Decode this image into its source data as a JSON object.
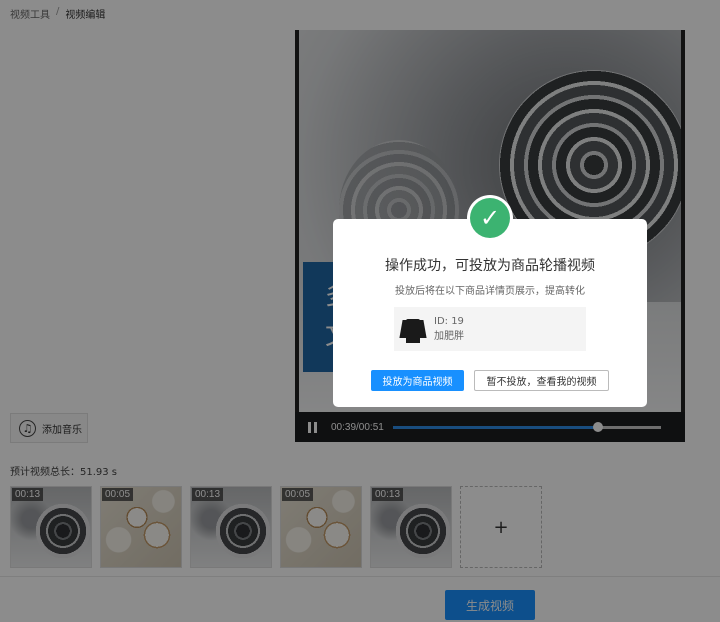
{
  "breadcrumb": {
    "items": [
      "视频工具",
      "视频编辑"
    ],
    "separator": "/"
  },
  "player": {
    "overlay_text": "多\n文",
    "time": "00:39/00:51",
    "progress_fraction": 0.7647,
    "state": "playing"
  },
  "music": {
    "label": "添加音乐",
    "icon": "music-note-icon"
  },
  "total_duration": "预计视频总长：51.93 s",
  "clips": [
    {
      "duration": "00:13",
      "thumb": "pinecone"
    },
    {
      "duration": "00:05",
      "thumb": "cotton"
    },
    {
      "duration": "00:13",
      "thumb": "pinecone"
    },
    {
      "duration": "00:05",
      "thumb": "cotton"
    },
    {
      "duration": "00:13",
      "thumb": "pinecone"
    }
  ],
  "add_clip_label": "+",
  "generate_button": "生成视频",
  "modal": {
    "icon": "check-circle-icon",
    "title": "操作成功，可投放为商品轮播视频",
    "subtitle": "投放后将在以下商品详情页展示，提高转化",
    "product": {
      "id": "ID: 19",
      "name": "加肥胖"
    },
    "primary_button": "投放为商品视频",
    "secondary_button": "暂不投放，查看我的视频"
  },
  "colors": {
    "accent": "#1890ff",
    "success": "#3cb371",
    "mask": "rgba(0,0,0,0.45)"
  }
}
